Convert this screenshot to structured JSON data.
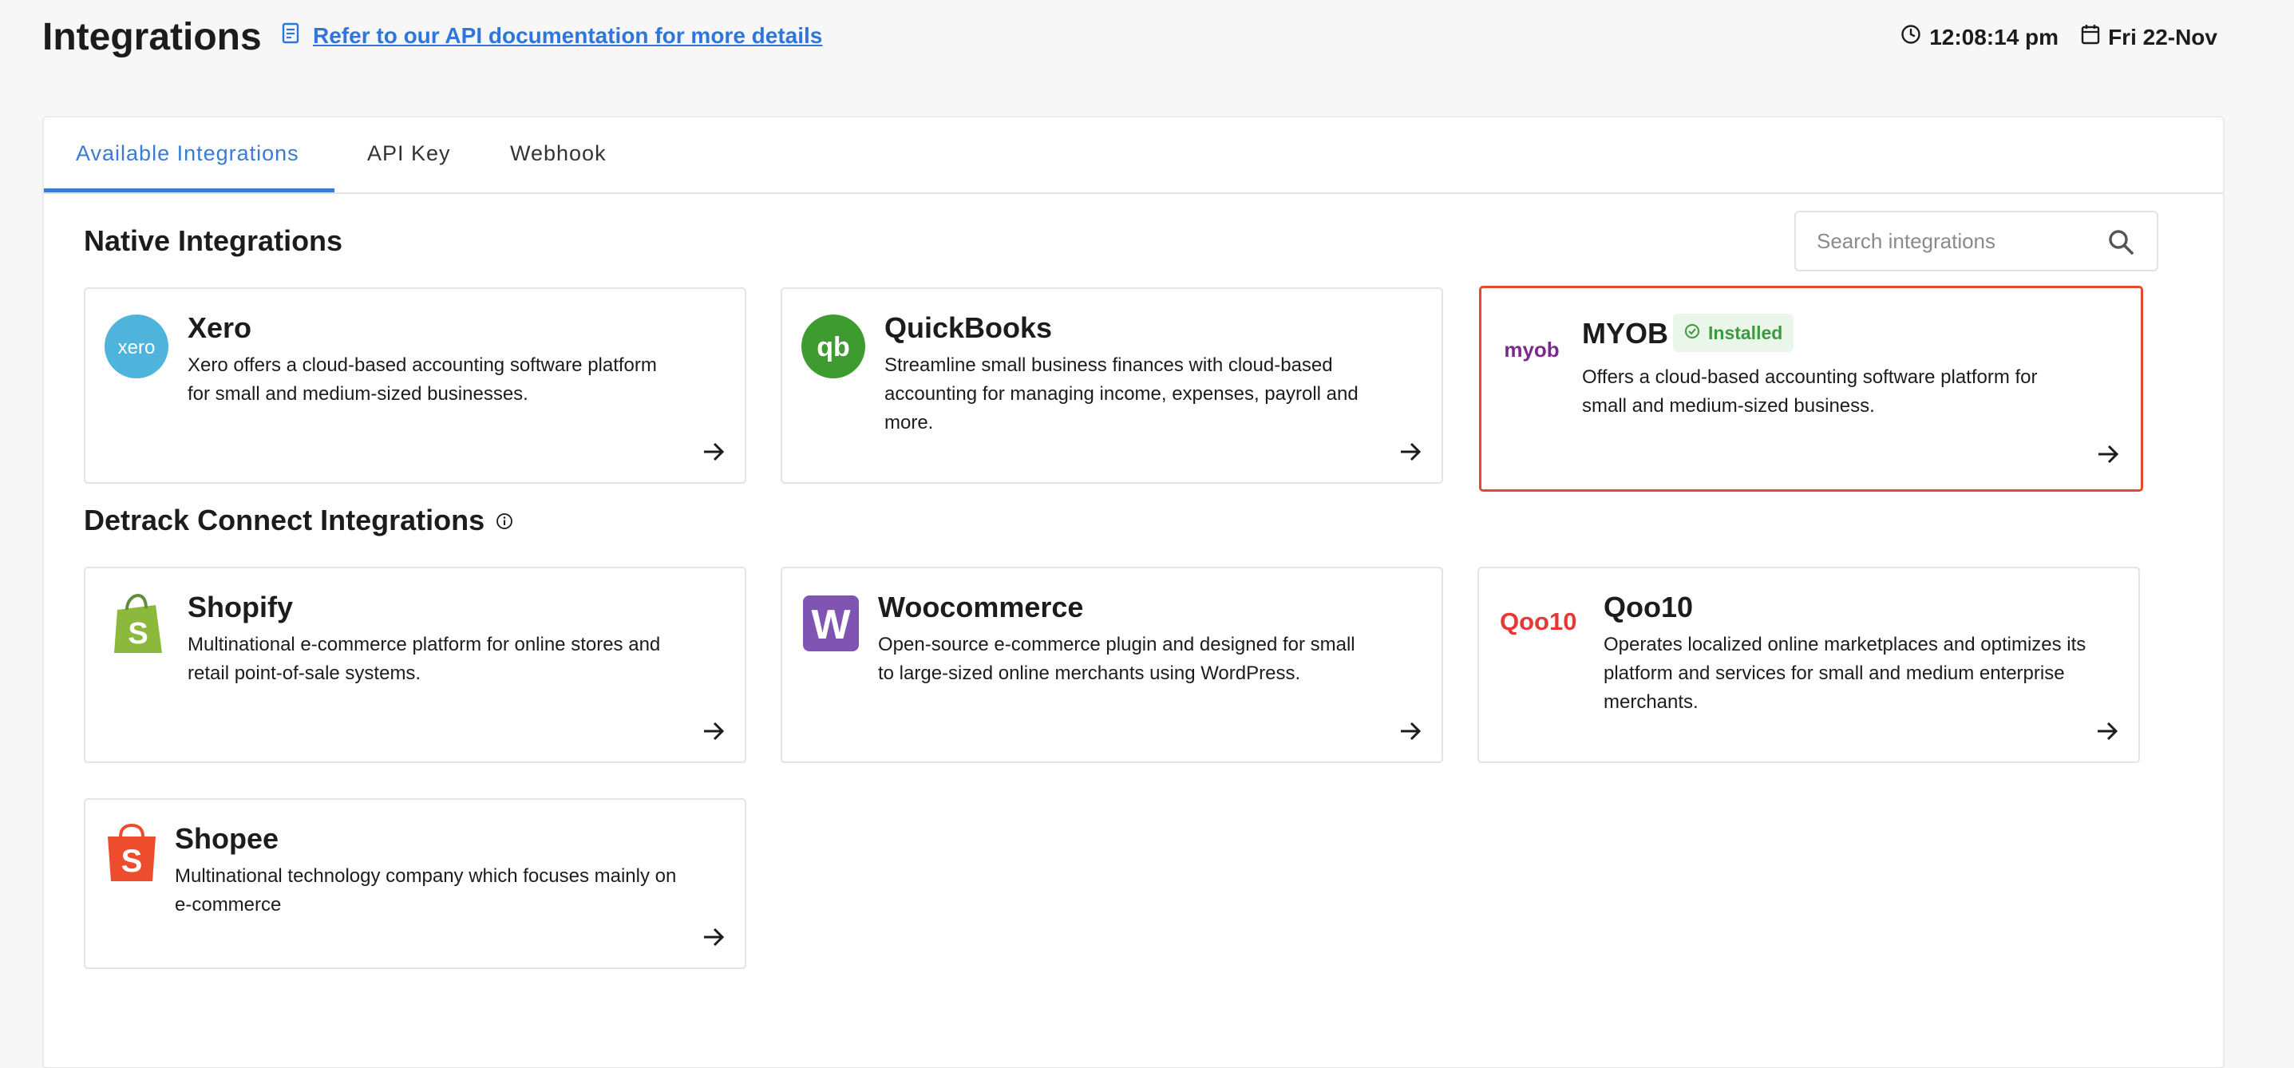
{
  "header": {
    "title": "Integrations",
    "doc_link": "Refer to our API documentation for more details",
    "time": "12:08:14 pm",
    "date": "Fri 22-Nov"
  },
  "tabs": [
    {
      "label": "Available Integrations",
      "active": true
    },
    {
      "label": "API Key",
      "active": false
    },
    {
      "label": "Webhook",
      "active": false
    }
  ],
  "search": {
    "placeholder": "Search integrations",
    "value": ""
  },
  "native": {
    "title": "Native Integrations",
    "cards": [
      {
        "name": "Xero",
        "logo_text": "xero",
        "description": "Xero offers a cloud-based accounting software platform for small and medium-sized businesses."
      },
      {
        "name": "QuickBooks",
        "logo_text": "qb",
        "description": "Streamline small business finances with cloud-based accounting for managing income, expenses, payroll and more."
      },
      {
        "name": "MYOB",
        "logo_text": "myob",
        "badge": "Installed",
        "description": "Offers a cloud-based accounting software platform for small and medium-sized business."
      }
    ]
  },
  "connect": {
    "title": "Detrack Connect Integrations",
    "cards": [
      {
        "name": "Shopify",
        "logo_text": "S",
        "description": "Multinational e-commerce platform for online stores and retail point-of-sale systems."
      },
      {
        "name": "Woocommerce",
        "logo_text": "W",
        "description": "Open-source e-commerce plugin and designed for small to large-sized online merchants using WordPress."
      },
      {
        "name": "Qoo10",
        "logo_text": "Qoo10",
        "description": "Operates localized online marketplaces and optimizes its platform and services for small and medium enterprise merchants."
      },
      {
        "name": "Shopee",
        "logo_text": "S",
        "description": "Multinational technology company which focuses mainly on e-commerce"
      }
    ]
  },
  "colors": {
    "accent": "#3a7bd5",
    "selected_border": "#e04a2f",
    "installed_green": "#3c9a3e",
    "xero": "#4fb4dc",
    "quickbooks": "#3e9b2f",
    "myob": "#7b2a8e",
    "shopify": "#8cb83c",
    "woocommerce": "#7f54b3",
    "qoo10": "#e53935",
    "shopee": "#ee4d2d"
  },
  "icons": [
    "document-icon",
    "clock-icon",
    "calendar-icon",
    "search-icon",
    "info-icon",
    "check-circle-icon",
    "arrow-right-icon"
  ]
}
